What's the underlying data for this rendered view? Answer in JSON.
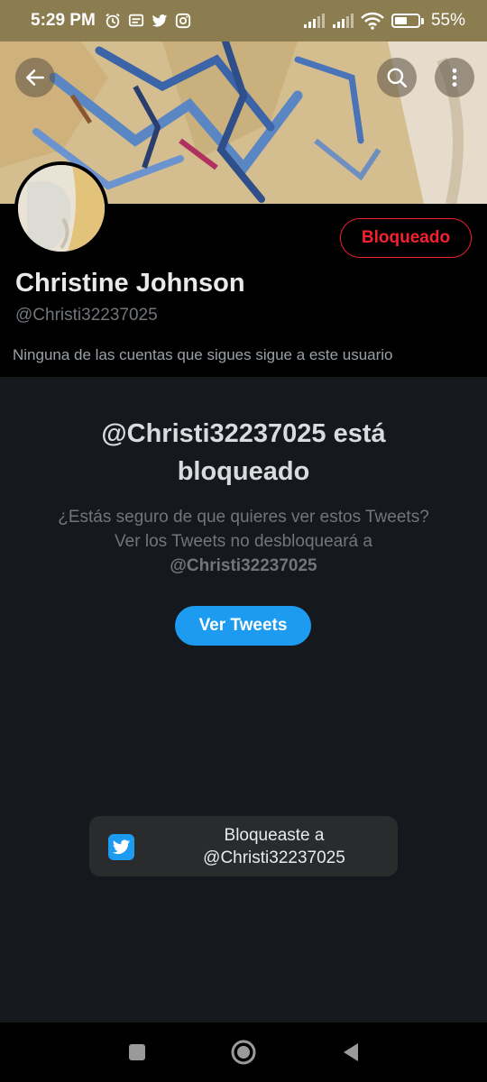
{
  "status_bar": {
    "time": "5:29 PM",
    "battery": "55%",
    "battery_level": 0.55,
    "left_icons": [
      "alarm-icon",
      "message-icon",
      "twitter-icon",
      "instagram-icon"
    ],
    "right_icons": [
      "signal-icon",
      "signal-icon",
      "wifi-icon",
      "battery-icon"
    ]
  },
  "header": {
    "icons": [
      "back-arrow-icon",
      "search-icon",
      "more-vertical-icon"
    ]
  },
  "profile": {
    "display_name": "Christine Johnson",
    "handle": "@Christi32237025",
    "blocked_label": "Bloqueado",
    "mutuals_text": "Ninguna de las cuentas que sigues sigue a este usuario"
  },
  "blocked": {
    "title": "@Christi32237025 está bloqueado",
    "description": "¿Estás seguro de que quieres ver estos Tweets? Ver los Tweets no desbloqueará a",
    "description_handle": "@Christi32237025",
    "view_button": "Ver Tweets"
  },
  "toast": {
    "line1": "Bloqueaste a",
    "line2": "@Christi32237025",
    "icon": "twitter-icon"
  },
  "nav": {
    "icons": [
      "recents-square-icon",
      "home-circle-icon",
      "back-triangle-icon"
    ]
  },
  "colors": {
    "accent": "#1d9bf0",
    "danger": "#f4212e",
    "status_bar": "#8b7d4f",
    "background": "#15181c"
  }
}
